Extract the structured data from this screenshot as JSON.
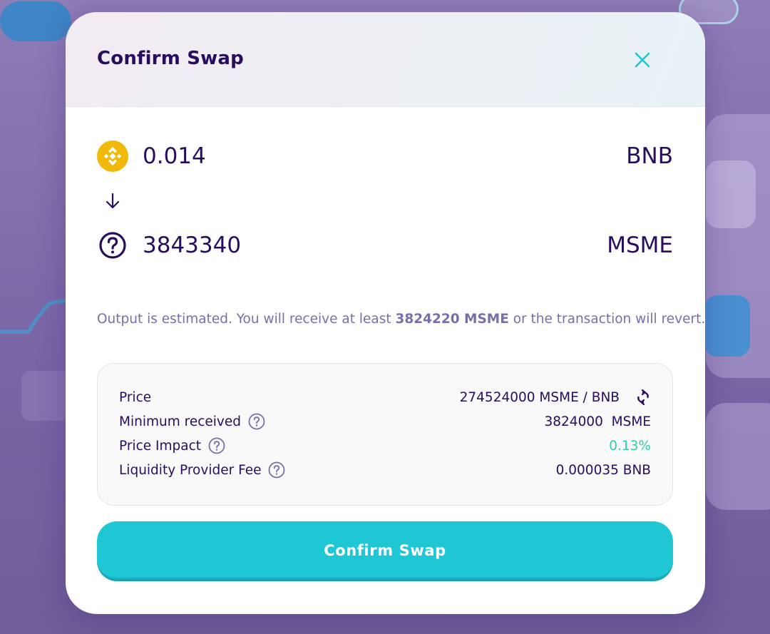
{
  "modal": {
    "title": "Confirm Swap",
    "close_icon": "close-icon"
  },
  "swap": {
    "from": {
      "amount": "0.014",
      "symbol": "BNB",
      "icon": "bnb-logo-icon"
    },
    "to": {
      "amount": "3843340",
      "symbol": "MSME",
      "icon": "question-circle-icon"
    },
    "arrow_icon": "arrow-down-icon"
  },
  "estimate_note": {
    "prefix": "Output is estimated. You will receive at least ",
    "amount": "3824220 MSME",
    "suffix": " or the transaction will revert."
  },
  "details": {
    "price": {
      "label": "Price",
      "value": "274524000 MSME / BNB"
    },
    "minimum_received": {
      "label": "Minimum received",
      "value": "3824000  MSME"
    },
    "price_impact": {
      "label": "Price Impact",
      "value": "0.13%"
    },
    "lp_fee": {
      "label": "Liquidity Provider Fee",
      "value": "0.000035 BNB"
    }
  },
  "confirm_button": {
    "label": "Confirm Swap"
  },
  "colors": {
    "primary": "#1fc7d4",
    "text": "#280d5f",
    "subtle": "#7a6eaa",
    "success": "#31d0aa",
    "bnb": "#f0b90b"
  }
}
